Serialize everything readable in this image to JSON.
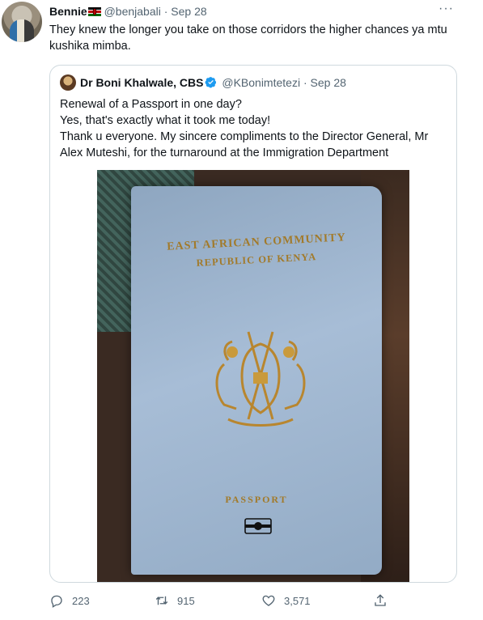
{
  "tweet": {
    "author_name": "Bennie",
    "handle": "@benjabali",
    "separator": "·",
    "time": "Sep 28",
    "text": "They knew the longer you take on those corridors the higher chances ya mtu kushika mimba.",
    "more_label": "···"
  },
  "quote": {
    "author_name": "Dr Boni Khalwale, CBS",
    "handle": "@KBonimtetezi",
    "separator": "·",
    "time": "Sep 28",
    "lines": [
      "Renewal of a Passport in one day?",
      "Yes, that's exactly what it took me today!",
      "Thank u everyone. My sincere compliments to the Director General, Mr Alex Muteshi, for the turnaround at the Immigration Department"
    ],
    "photo": {
      "line1": "EAST AFRICAN COMMUNITY",
      "line2": "REPUBLIC OF KENYA",
      "line3": "PASSPORT"
    }
  },
  "actions": {
    "replies": "223",
    "retweets": "915",
    "likes": "3,571"
  },
  "colors": {
    "secondary_text": "#536471",
    "verified": "#1d9bf0",
    "border": "#cfd9de"
  }
}
